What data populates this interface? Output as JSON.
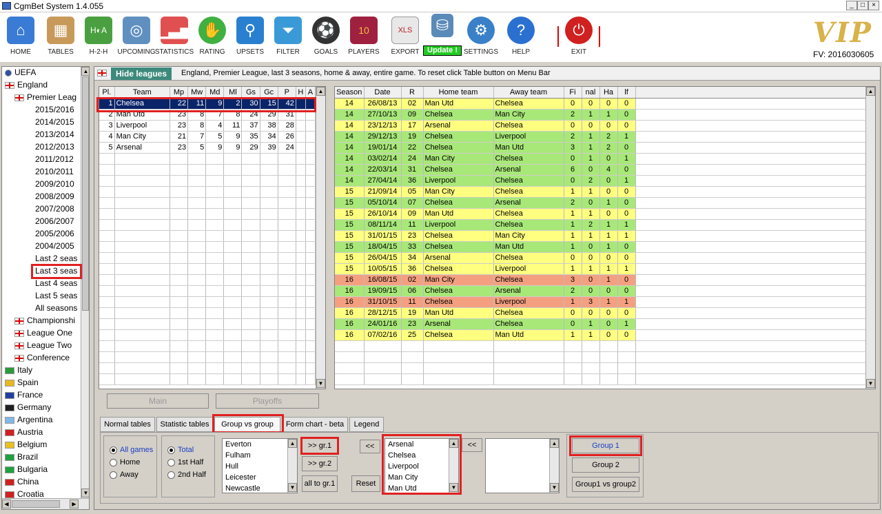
{
  "window": {
    "title": "CgmBet System  1.4.055",
    "min": "_",
    "max": "□",
    "close": "×"
  },
  "toolbar": {
    "items": [
      {
        "label": "HOME",
        "icon": "home-icon"
      },
      {
        "label": "TABLES",
        "icon": "tables-icon"
      },
      {
        "label": "H-2-H",
        "icon": "h2h-icon"
      },
      {
        "label": "UPCOMING",
        "icon": "upcoming-icon"
      },
      {
        "label": "STATISTICS",
        "icon": "statistics-icon"
      },
      {
        "label": "RATING",
        "icon": "rating-icon"
      },
      {
        "label": "UPSETS",
        "icon": "upsets-icon"
      },
      {
        "label": "FILTER",
        "icon": "filter-icon"
      },
      {
        "label": "GOALS",
        "icon": "goals-icon"
      },
      {
        "label": "PLAYERS",
        "icon": "players-icon"
      },
      {
        "label": "EXPORT",
        "icon": "export-icon"
      },
      {
        "label": "SETTINGS",
        "icon": "settings-icon"
      },
      {
        "label": "HELP",
        "icon": "help-icon"
      },
      {
        "label": "EXIT",
        "icon": "exit-icon"
      }
    ],
    "update_label": "Update !",
    "vip": "VIP",
    "fv": "FV: 2016030605"
  },
  "tree": {
    "top": [
      {
        "label": "UEFA",
        "flag": "#3050a0"
      },
      {
        "label": "England",
        "flag": "eng"
      }
    ],
    "premier": "Premier Leag",
    "seasons": [
      "2015/2016",
      "2014/2015",
      "2013/2014",
      "2012/2013",
      "2011/2012",
      "2010/2011",
      "2009/2010",
      "2008/2009",
      "2007/2008",
      "2006/2007",
      "2005/2006",
      "2004/2005",
      "Last 2 seas",
      "Last 3 seas",
      "Last 4 seas",
      "Last 5 seas",
      "All seasons"
    ],
    "leagues": [
      "Championshi",
      "League One",
      "League Two",
      "Conference"
    ],
    "countries": [
      {
        "label": "Italy",
        "flag": "#2a9a3a"
      },
      {
        "label": "Spain",
        "flag": "#e8b820"
      },
      {
        "label": "France",
        "flag": "#2040a0"
      },
      {
        "label": "Germany",
        "flag": "#202020"
      },
      {
        "label": "Argentina",
        "flag": "#80b8e8"
      },
      {
        "label": "Austria",
        "flag": "#d02020"
      },
      {
        "label": "Belgium",
        "flag": "#e8c020"
      },
      {
        "label": "Brazil",
        "flag": "#20a040"
      },
      {
        "label": "Bulgaria",
        "flag": "#20a040"
      },
      {
        "label": "China",
        "flag": "#d02020"
      },
      {
        "label": "Croatia",
        "flag": "#d02020"
      }
    ]
  },
  "infobar": {
    "hide_label": "Hide leagues",
    "text": "England, Premier League, last 3 seasons, home & away, entire game. To reset click Table button on Menu Bar"
  },
  "standings": {
    "headers": [
      "Pl.",
      "Team",
      "Mp",
      "Mw",
      "Md",
      "Ml",
      "Gs",
      "Gc",
      "P",
      "H",
      "A"
    ],
    "rows": [
      [
        "1",
        "Chelsea",
        "22",
        "11",
        "9",
        "2",
        "30",
        "15",
        "42",
        "",
        ""
      ],
      [
        "2",
        "Man Utd",
        "23",
        "8",
        "7",
        "8",
        "24",
        "29",
        "31",
        "",
        ""
      ],
      [
        "3",
        "Liverpool",
        "23",
        "8",
        "4",
        "11",
        "37",
        "38",
        "28",
        "",
        ""
      ],
      [
        "4",
        "Man City",
        "21",
        "7",
        "5",
        "9",
        "35",
        "34",
        "26",
        "",
        ""
      ],
      [
        "5",
        "Arsenal",
        "23",
        "5",
        "9",
        "9",
        "29",
        "39",
        "24",
        "",
        ""
      ]
    ]
  },
  "matches": {
    "headers": [
      "Season",
      "Date",
      "R",
      "Home team",
      "Away team",
      "Fi",
      "nal",
      "Ha",
      "lf"
    ],
    "rows": [
      [
        "14",
        "26/08/13",
        "02",
        "Man Utd",
        "Chelsea",
        "0",
        "0",
        "0",
        "0",
        "y"
      ],
      [
        "14",
        "27/10/13",
        "09",
        "Chelsea",
        "Man City",
        "2",
        "1",
        "1",
        "0",
        "g"
      ],
      [
        "14",
        "23/12/13",
        "17",
        "Arsenal",
        "Chelsea",
        "0",
        "0",
        "0",
        "0",
        "y"
      ],
      [
        "14",
        "29/12/13",
        "19",
        "Chelsea",
        "Liverpool",
        "2",
        "1",
        "2",
        "1",
        "g"
      ],
      [
        "14",
        "19/01/14",
        "22",
        "Chelsea",
        "Man Utd",
        "3",
        "1",
        "2",
        "0",
        "g"
      ],
      [
        "14",
        "03/02/14",
        "24",
        "Man City",
        "Chelsea",
        "0",
        "1",
        "0",
        "1",
        "g"
      ],
      [
        "14",
        "22/03/14",
        "31",
        "Chelsea",
        "Arsenal",
        "6",
        "0",
        "4",
        "0",
        "g"
      ],
      [
        "14",
        "27/04/14",
        "36",
        "Liverpool",
        "Chelsea",
        "0",
        "2",
        "0",
        "1",
        "g"
      ],
      [
        "15",
        "21/09/14",
        "05",
        "Man City",
        "Chelsea",
        "1",
        "1",
        "0",
        "0",
        "y"
      ],
      [
        "15",
        "05/10/14",
        "07",
        "Chelsea",
        "Arsenal",
        "2",
        "0",
        "1",
        "0",
        "g"
      ],
      [
        "15",
        "26/10/14",
        "09",
        "Man Utd",
        "Chelsea",
        "1",
        "1",
        "0",
        "0",
        "y"
      ],
      [
        "15",
        "08/11/14",
        "11",
        "Liverpool",
        "Chelsea",
        "1",
        "2",
        "1",
        "1",
        "g"
      ],
      [
        "15",
        "31/01/15",
        "23",
        "Chelsea",
        "Man City",
        "1",
        "1",
        "1",
        "1",
        "y"
      ],
      [
        "15",
        "18/04/15",
        "33",
        "Chelsea",
        "Man Utd",
        "1",
        "0",
        "1",
        "0",
        "g"
      ],
      [
        "15",
        "26/04/15",
        "34",
        "Arsenal",
        "Chelsea",
        "0",
        "0",
        "0",
        "0",
        "y"
      ],
      [
        "15",
        "10/05/15",
        "36",
        "Chelsea",
        "Liverpool",
        "1",
        "1",
        "1",
        "1",
        "y"
      ],
      [
        "16",
        "16/08/15",
        "02",
        "Man City",
        "Chelsea",
        "3",
        "0",
        "1",
        "0",
        "r"
      ],
      [
        "16",
        "19/09/15",
        "06",
        "Chelsea",
        "Arsenal",
        "2",
        "0",
        "0",
        "0",
        "g"
      ],
      [
        "16",
        "31/10/15",
        "11",
        "Chelsea",
        "Liverpool",
        "1",
        "3",
        "1",
        "1",
        "r"
      ],
      [
        "16",
        "28/12/15",
        "19",
        "Man Utd",
        "Chelsea",
        "0",
        "0",
        "0",
        "0",
        "y"
      ],
      [
        "16",
        "24/01/16",
        "23",
        "Arsenal",
        "Chelsea",
        "0",
        "1",
        "0",
        "1",
        "g"
      ],
      [
        "16",
        "07/02/16",
        "25",
        "Chelsea",
        "Man Utd",
        "1",
        "1",
        "0",
        "0",
        "y"
      ]
    ]
  },
  "buttons": {
    "main": "Main",
    "playoffs": "Playoffs"
  },
  "tabs": [
    "Normal tables",
    "Statistic tables",
    "Group vs group",
    "Form chart  - beta",
    "Legend"
  ],
  "group": {
    "scope": [
      "All games",
      "Home",
      "Away"
    ],
    "period": [
      "Total",
      "1st Half",
      "2nd Half"
    ],
    "available": [
      "Everton",
      "Fulham",
      "Hull",
      "Leicester",
      "Newcastle"
    ],
    "gr1_label": ">> gr.1",
    "gr2_label": ">> gr.2",
    "all_label": "all to gr.1",
    "back1_label": "<<",
    "back2_label": "<<",
    "reset_label": "Reset",
    "group1_teams": [
      "Arsenal",
      "Chelsea",
      "Liverpool",
      "Man City",
      "Man Utd"
    ],
    "group1_btn": "Group 1",
    "group2_btn": "Group 2",
    "vs_btn": "Group1 vs group2"
  }
}
